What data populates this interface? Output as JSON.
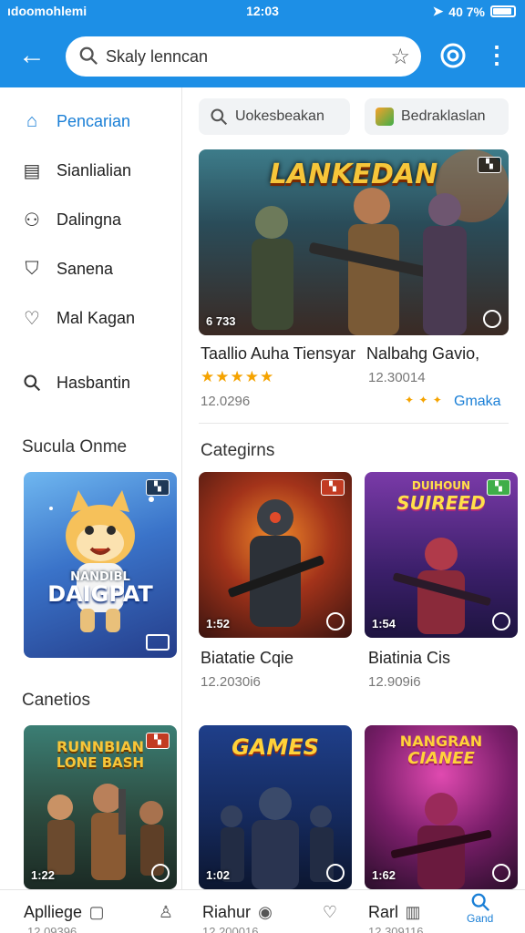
{
  "status_bar": {
    "left": "ıdoomohlemi",
    "time": "12:03",
    "right": "40 7%"
  },
  "app_bar": {
    "search_value": "Skaly lenncan"
  },
  "sidebar": {
    "items": [
      {
        "label": "Pencarian",
        "icon": "home-icon"
      },
      {
        "label": "Sianlialian",
        "icon": "folder-icon"
      },
      {
        "label": "Dalingna",
        "icon": "people-icon"
      },
      {
        "label": "Sanena",
        "icon": "shield-icon"
      },
      {
        "label": "Mal Kagan",
        "icon": "heart-icon"
      },
      {
        "label": "Hasbantin",
        "icon": "search-icon"
      }
    ],
    "heading_1": "Sucula Onme",
    "card_1": {
      "art_title": "DAIGPAT",
      "art_subtitle": "NANDIBL"
    },
    "heading_2": "Canetios",
    "card_2": {
      "time": "1:22",
      "art_title": "LONE BASH",
      "art_subtitle": "RUNNBIAN"
    }
  },
  "chips": [
    {
      "label": "Uokesbeakan"
    },
    {
      "label": "Bedraklaslan"
    }
  ],
  "featured": {
    "art_title": "LANKEDAN",
    "time": "6 733",
    "title_left": "Taallio Auha Tiensyar",
    "title_right": "Nalbahg Gavio,",
    "meta_left": "12.0296",
    "meta_right": "12.30014",
    "stars": "★★★★★",
    "more": "Gmaka"
  },
  "categories": {
    "title": "Categirns",
    "tiles": [
      {
        "time": "1:52",
        "title": "Biatatie Cqie",
        "meta": "12.2030i6"
      },
      {
        "time": "1:54",
        "title": "Biatinia Cis",
        "meta": "12.909i6",
        "art_title": "SUIREED",
        "art_subtitle": "DUIHOUN"
      }
    ]
  },
  "second_row": [
    {
      "time": "1:02",
      "art_title": "GAMES"
    },
    {
      "time": "1:62",
      "art_title": "CIANEE",
      "art_subtitle": "NANGRAN"
    }
  ],
  "bottom_bar": {
    "items": [
      "Aplliege",
      "Riahur",
      "Rarl"
    ],
    "subs": [
      "12.09396",
      "12.200016",
      "12.309116"
    ],
    "last_label": "Gand"
  },
  "colors": {
    "primary": "#1d8fe6",
    "link": "#1a7fd6",
    "star": "#f5a300"
  }
}
